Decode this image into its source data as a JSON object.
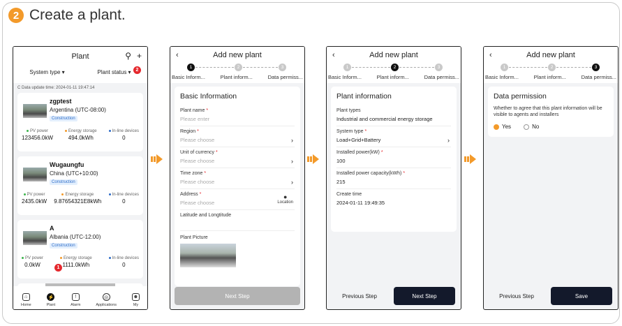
{
  "header": {
    "step_number": "2",
    "title": "Create a plant."
  },
  "screen1": {
    "title": "Plant",
    "system_type": "System type ▾",
    "plant_status": "Plant status ▾",
    "update_time": "C Data update time: 2024-01-11 19:47:14",
    "plants": [
      {
        "name": "zgptest",
        "zone": "Argentina (UTC-08:00)",
        "status": "Construction",
        "pv": "123456.0kW",
        "storage": "494.0kWh",
        "devices": "0"
      },
      {
        "name": "Wugaungfu",
        "zone": "China (UTC+10:00)",
        "status": "Construction",
        "pv": "2435.0kW",
        "storage": "9.87654321E8kWh",
        "devices": "0"
      },
      {
        "name": "A",
        "zone": "Albania (UTC-12:00)",
        "status": "Construction",
        "pv": "0.0kW",
        "storage": "1111.0kWh",
        "devices": "0"
      }
    ],
    "stat_labels": {
      "pv": "PV power",
      "storage": "Energy storage",
      "devices": "In-line devices"
    },
    "tabs": [
      "Home",
      "Plant",
      "Alarm",
      "Applications",
      "My"
    ],
    "badge1": "1",
    "badge2": "2"
  },
  "form": {
    "title": "Add new plant",
    "steps": [
      "Basic Inform...",
      "Plant inform...",
      "Data permiss..."
    ],
    "step_nums": [
      "1",
      "2",
      "3"
    ]
  },
  "screen2": {
    "section": "Basic Information",
    "plant_name_label": "Plant name",
    "plant_name_ph": "Please enter",
    "region_label": "Region",
    "region_ph": "Please choose",
    "currency_label": "Unit of currency",
    "currency_ph": "Please choose",
    "timezone_label": "Time zone",
    "timezone_ph": "Please choose",
    "address_label": "Address",
    "address_ph": "Please choose",
    "location": "Location",
    "latlng_label": "Latitude and Longtitude",
    "picture_label": "Plant Picture",
    "next": "Next Step"
  },
  "screen3": {
    "section": "Plant information",
    "types_label": "Plant types",
    "types_val": "Industrial and commercial energy storage",
    "system_label": "System type",
    "system_val": "Load+Grid+Battery",
    "power_label": "Installed power(kW)",
    "power_val": "100",
    "capacity_label": "Installed power capacity(kWh)",
    "capacity_val": "215",
    "created_label": "Create time",
    "created_val": "2024-01-11 19:49:35",
    "prev": "Previous Step",
    "next": "Next Step"
  },
  "screen4": {
    "section": "Data permission",
    "question": "Whether to agree that this plant information will be visible to agents and installers",
    "yes": "Yes",
    "no": "No",
    "prev": "Previous Step",
    "save": "Save"
  }
}
